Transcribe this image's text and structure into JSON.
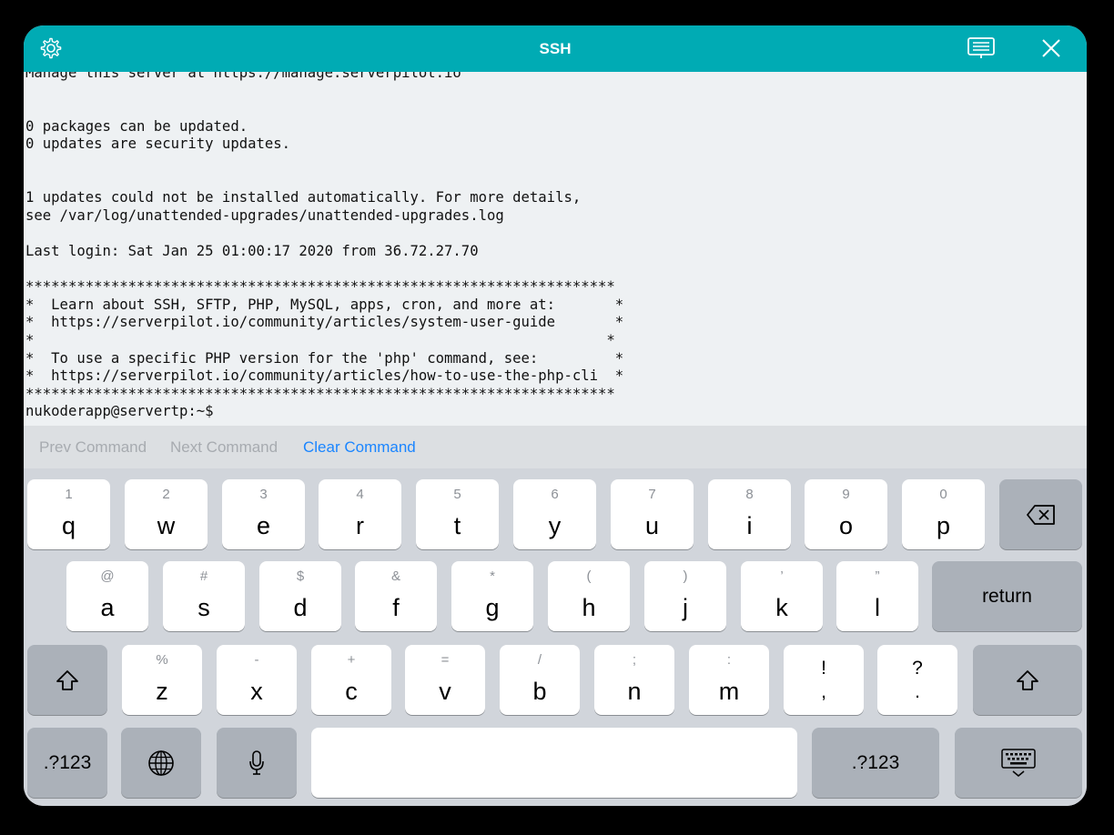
{
  "nav": {
    "title": "SSH",
    "settings_icon": "gear-icon",
    "keyboard_icon": "keyboard-icon",
    "close_icon": "close-icon"
  },
  "terminal": {
    "lines": [
      "Manage this server at https://manage.serverpilot.io",
      "",
      "",
      "0 packages can be updated.",
      "0 updates are security updates.",
      "",
      "",
      "1 updates could not be installed automatically. For more details,",
      "see /var/log/unattended-upgrades/unattended-upgrades.log",
      "",
      "Last login: Sat Jan 25 01:00:17 2020 from 36.72.27.70",
      "",
      "*********************************************************************",
      "*  Learn about SSH, SFTP, PHP, MySQL, apps, cron, and more at:       *",
      "*  https://serverpilot.io/community/articles/system-user-guide       *",
      "*                                                                   *",
      "*  To use a specific PHP version for the 'php' command, see:         *",
      "*  https://serverpilot.io/community/articles/how-to-use-the-php-cli  *",
      "*********************************************************************",
      "nukoderapp@servertp:~$"
    ]
  },
  "command_bar": {
    "prev": "Prev Command",
    "next": "Next Command",
    "clear": "Clear Command"
  },
  "keyboard": {
    "row1": [
      {
        "hint": "1",
        "key": "q"
      },
      {
        "hint": "2",
        "key": "w"
      },
      {
        "hint": "3",
        "key": "e"
      },
      {
        "hint": "4",
        "key": "r"
      },
      {
        "hint": "5",
        "key": "t"
      },
      {
        "hint": "6",
        "key": "y"
      },
      {
        "hint": "7",
        "key": "u"
      },
      {
        "hint": "8",
        "key": "i"
      },
      {
        "hint": "9",
        "key": "o"
      },
      {
        "hint": "0",
        "key": "p"
      }
    ],
    "row2": [
      {
        "hint": "@",
        "key": "a"
      },
      {
        "hint": "#",
        "key": "s"
      },
      {
        "hint": "$",
        "key": "d"
      },
      {
        "hint": "&",
        "key": "f"
      },
      {
        "hint": "*",
        "key": "g"
      },
      {
        "hint": "(",
        "key": "h"
      },
      {
        "hint": ")",
        "key": "j"
      },
      {
        "hint": "’",
        "key": "k"
      },
      {
        "hint": "”",
        "key": "l"
      }
    ],
    "row3": [
      {
        "hint": "%",
        "key": "z"
      },
      {
        "hint": "-",
        "key": "x"
      },
      {
        "hint": "+",
        "key": "c"
      },
      {
        "hint": "=",
        "key": "v"
      },
      {
        "hint": "/",
        "key": "b"
      },
      {
        "hint": ";",
        "key": "n"
      },
      {
        "hint": ":",
        "key": "m"
      },
      {
        "hint": "!",
        "key": ","
      },
      {
        "hint": "?",
        "key": "."
      }
    ],
    "return_label": "return",
    "numbers_label": ".?123",
    "icons": {
      "backspace": "backspace-icon",
      "shift": "shift-icon",
      "globe": "globe-icon",
      "mic": "microphone-icon",
      "dismiss": "keyboard-dismiss-icon"
    }
  }
}
